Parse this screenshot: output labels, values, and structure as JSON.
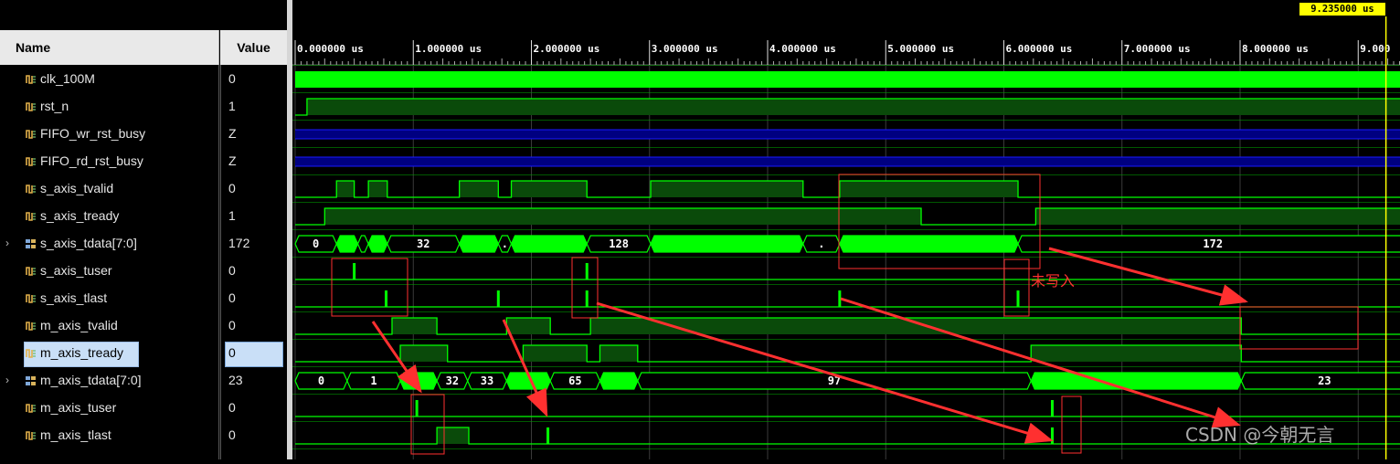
{
  "header": {
    "name_label": "Name",
    "value_label": "Value"
  },
  "cursor": {
    "time_label": "9.235000 us",
    "time_us": 9.235
  },
  "timeline": {
    "ticks": [
      "0.000000 us",
      "1.000000 us",
      "2.000000 us",
      "3.000000 us",
      "4.000000 us",
      "5.000000 us",
      "6.000000 us",
      "7.000000 us",
      "8.000000 us",
      "9.000"
    ],
    "tick_times_us": [
      0,
      1,
      2,
      3,
      4,
      5,
      6,
      7,
      8,
      9
    ]
  },
  "signals": [
    {
      "name": "clk_100M",
      "value": "0",
      "kind": "clock"
    },
    {
      "name": "rst_n",
      "value": "1",
      "kind": "bit",
      "transitions": [
        [
          0,
          0
        ],
        [
          0.1,
          1
        ]
      ]
    },
    {
      "name": "FIFO_wr_rst_busy",
      "value": "Z",
      "kind": "z"
    },
    {
      "name": "FIFO_rd_rst_busy",
      "value": "Z",
      "kind": "z"
    },
    {
      "name": "s_axis_tvalid",
      "value": "0",
      "kind": "bit",
      "transitions": [
        [
          0,
          0
        ],
        [
          0.35,
          1
        ],
        [
          0.5,
          0
        ],
        [
          0.62,
          1
        ],
        [
          0.78,
          0
        ],
        [
          1.39,
          1
        ],
        [
          1.72,
          0
        ],
        [
          1.83,
          1
        ],
        [
          2.47,
          0
        ],
        [
          3.01,
          1
        ],
        [
          4.3,
          0
        ],
        [
          4.61,
          1
        ],
        [
          6.12,
          0
        ]
      ]
    },
    {
      "name": "s_axis_tready",
      "value": "1",
      "kind": "bit",
      "transitions": [
        [
          0,
          0
        ],
        [
          0.25,
          1
        ],
        [
          5.3,
          0
        ],
        [
          6.27,
          1
        ]
      ]
    },
    {
      "name": "s_axis_tdata[7:0]",
      "value": "172",
      "kind": "bus",
      "expandable": true,
      "segments": [
        {
          "start": 0,
          "end": 0.35,
          "label": "0",
          "solid": false
        },
        {
          "start": 0.35,
          "end": 0.53,
          "label": "",
          "solid": true
        },
        {
          "start": 0.53,
          "end": 0.62,
          "label": "",
          "solid": false
        },
        {
          "start": 0.62,
          "end": 0.78,
          "label": "",
          "solid": true
        },
        {
          "start": 0.78,
          "end": 1.39,
          "label": "32",
          "solid": false
        },
        {
          "start": 1.39,
          "end": 1.72,
          "label": "",
          "solid": true
        },
        {
          "start": 1.72,
          "end": 1.83,
          "label": ".",
          "solid": false
        },
        {
          "start": 1.83,
          "end": 2.47,
          "label": "",
          "solid": true
        },
        {
          "start": 2.47,
          "end": 3.01,
          "label": "128",
          "solid": false
        },
        {
          "start": 3.01,
          "end": 4.3,
          "label": "",
          "solid": true
        },
        {
          "start": 4.3,
          "end": 4.61,
          "label": ".",
          "solid": false
        },
        {
          "start": 4.61,
          "end": 6.12,
          "label": "",
          "solid": true
        },
        {
          "start": 6.12,
          "end": 9.42,
          "label": "172",
          "solid": false
        }
      ]
    },
    {
      "name": "s_axis_tuser",
      "value": "0",
      "kind": "pulse",
      "pulses": [
        0.5,
        2.47
      ]
    },
    {
      "name": "s_axis_tlast",
      "value": "0",
      "kind": "pulse",
      "pulses": [
        0.77,
        1.72,
        2.47,
        4.61,
        6.12
      ]
    },
    {
      "name": "m_axis_tvalid",
      "value": "0",
      "kind": "bit",
      "transitions": [
        [
          0,
          0
        ],
        [
          0.82,
          1
        ],
        [
          1.2,
          0
        ],
        [
          1.79,
          1
        ],
        [
          2.16,
          0
        ],
        [
          2.5,
          1
        ],
        [
          8.01,
          0
        ]
      ]
    },
    {
      "name": "m_axis_tready",
      "value": "0",
      "kind": "bit",
      "selected": true,
      "transitions": [
        [
          0,
          0
        ],
        [
          0.89,
          1
        ],
        [
          1.29,
          0
        ],
        [
          1.93,
          1
        ],
        [
          2.47,
          0
        ],
        [
          2.58,
          1
        ],
        [
          2.9,
          0
        ],
        [
          6.23,
          1
        ],
        [
          8.01,
          0
        ]
      ]
    },
    {
      "name": "m_axis_tdata[7:0]",
      "value": "23",
      "kind": "bus",
      "expandable": true,
      "segments": [
        {
          "start": 0,
          "end": 0.44,
          "label": "0",
          "solid": false
        },
        {
          "start": 0.44,
          "end": 0.89,
          "label": "1",
          "solid": false
        },
        {
          "start": 0.89,
          "end": 1.2,
          "label": "",
          "solid": true
        },
        {
          "start": 1.2,
          "end": 1.46,
          "label": "32",
          "solid": false
        },
        {
          "start": 1.46,
          "end": 1.79,
          "label": "33",
          "solid": false
        },
        {
          "start": 1.79,
          "end": 2.16,
          "label": "",
          "solid": true
        },
        {
          "start": 2.16,
          "end": 2.58,
          "label": "65",
          "solid": false
        },
        {
          "start": 2.58,
          "end": 2.9,
          "label": "",
          "solid": true
        },
        {
          "start": 2.9,
          "end": 6.23,
          "label": "97",
          "solid": false
        },
        {
          "start": 6.23,
          "end": 8.01,
          "label": "",
          "solid": true
        },
        {
          "start": 8.01,
          "end": 9.42,
          "label": "23",
          "solid": false
        }
      ]
    },
    {
      "name": "m_axis_tuser",
      "value": "0",
      "kind": "pulse",
      "pulses": [
        1.03,
        6.41
      ]
    },
    {
      "name": "m_axis_tlast",
      "value": "0",
      "kind": "bit",
      "transitions": [
        [
          0,
          0
        ],
        [
          1.2,
          1
        ],
        [
          1.47,
          0
        ]
      ],
      "pulses": [
        2.14,
        6.41
      ]
    }
  ],
  "annotation": {
    "text": "未写入"
  },
  "watermark": "CSDN @今朝无言",
  "colors": {
    "wave_green": "#00ff00",
    "wave_fill": "#0a4a0a",
    "z_blue": "#000080",
    "grid": "#00a000",
    "annotation_red": "#ff3030",
    "cursor": "#ffff00"
  }
}
